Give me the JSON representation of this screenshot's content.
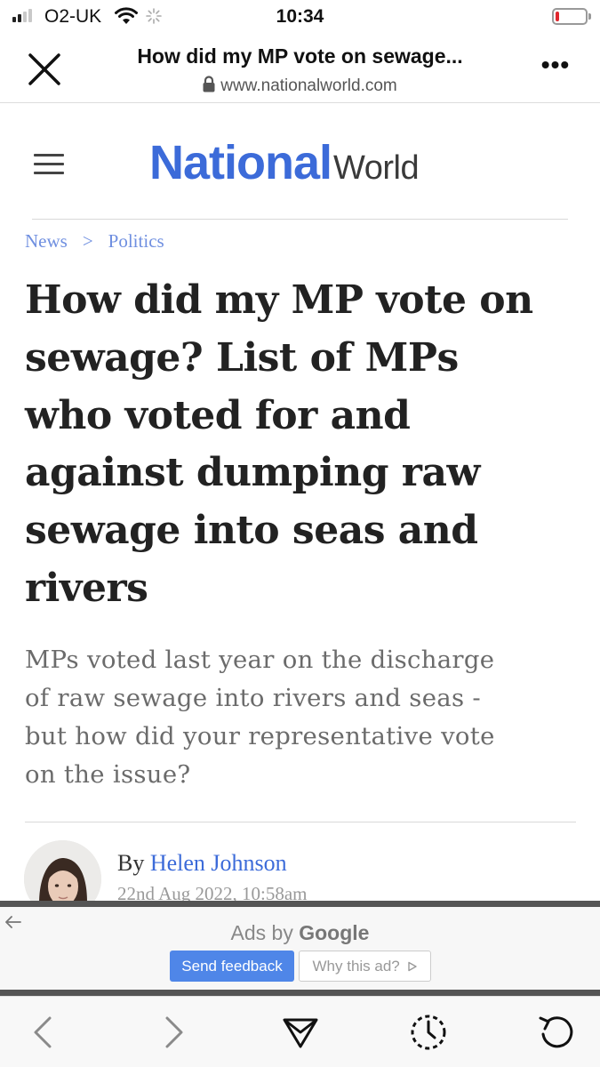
{
  "status_bar": {
    "carrier": "O2-UK",
    "time": "10:34",
    "signal_bars_active": 2,
    "signal_bars_total": 4,
    "battery_level": 0.12,
    "battery_color": "#e0262d"
  },
  "browser": {
    "page_title": "How did my MP vote on sewage...",
    "url": "www.nationalworld.com",
    "close_icon": "close-icon",
    "more_icon": "more-options-icon",
    "more_label": "•••"
  },
  "site": {
    "logo_primary": "National",
    "logo_secondary": "World",
    "brand_color": "#3c6bd9",
    "menu_icon": "hamburger-menu-icon"
  },
  "breadcrumb": {
    "items": [
      "News",
      "Politics"
    ],
    "separator": ">"
  },
  "article": {
    "headline_lines": [
      "How did my MP vote on",
      "sewage? List of MPs",
      "who voted for and",
      "against dumping raw",
      "sewage into seas and",
      "rivers"
    ],
    "standfirst_lines": [
      "MPs voted last year on the discharge",
      "of raw sewage into rivers and seas -",
      "but how did your representative vote",
      "on the issue?"
    ],
    "byline_prefix": "By",
    "author": "Helen Johnson",
    "date": "22nd Aug 2022, 10:58am"
  },
  "ad": {
    "label_prefix": "Ads by",
    "label_brand": "Google",
    "feedback_button": "Send feedback",
    "why_button": "Why this ad?",
    "back_icon": "back-arrow-icon"
  },
  "toolbar": {
    "items": [
      "back-icon",
      "forward-icon",
      "share-icon",
      "history-icon",
      "reload-icon"
    ]
  }
}
